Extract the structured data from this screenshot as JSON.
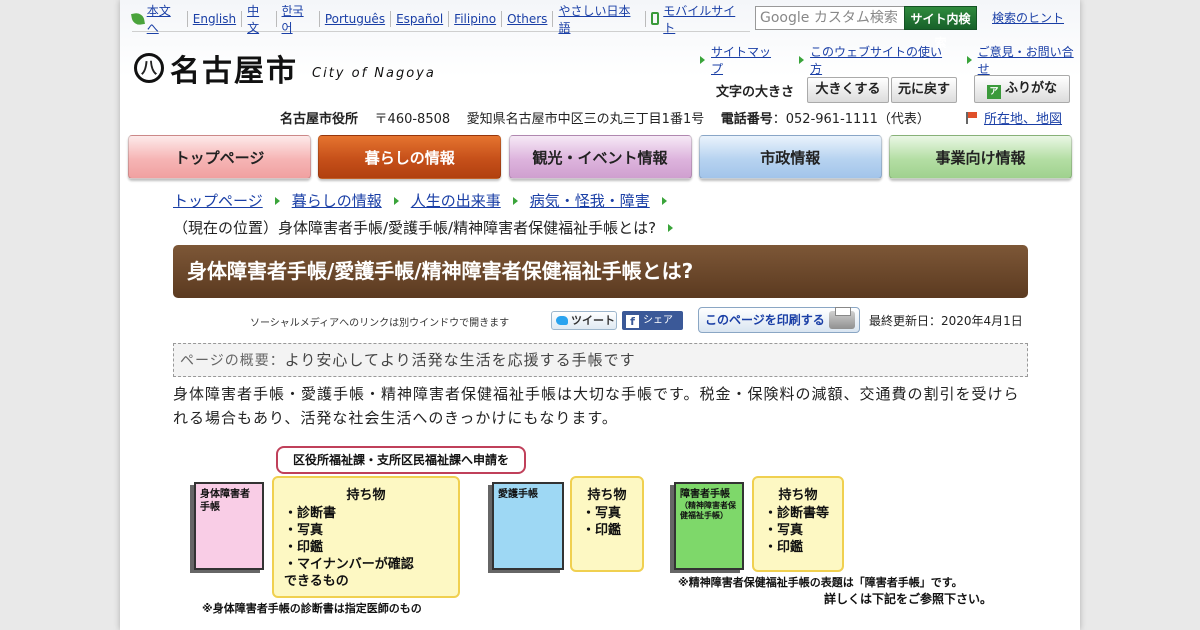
{
  "lang_bar": {
    "items": [
      "本文へ",
      "English",
      "中文",
      "한국어",
      "Português",
      "Español",
      "Filipino",
      "Others",
      "やさしい日本語",
      "モバイルサイト"
    ]
  },
  "search": {
    "placeholder": "Google カスタム検索",
    "button": "サイト内検索",
    "hint": "検索のヒント"
  },
  "logo": {
    "mark": "八",
    "name": "名古屋市",
    "sub": "City of Nagoya"
  },
  "util_links": [
    "サイトマップ",
    "このウェブサイトの使い方",
    "ご意見・お問い合せ"
  ],
  "font_size": {
    "label": "文字の大きさ",
    "larger": "大きくする",
    "reset": "元に戻す",
    "furigana": "ふりがな"
  },
  "address": {
    "office": "名古屋市役所",
    "postal": "〒460-8508",
    "street": "愛知県名古屋市中区三の丸三丁目1番1号",
    "phone_label": "電話番号",
    "phone": "：052-961-1111（代表）",
    "map_link": "所在地、地図"
  },
  "nav": [
    "トップページ",
    "暮らしの情報",
    "観光・イベント情報",
    "市政情報",
    "事業向け情報"
  ],
  "breadcrumb": [
    "トップページ",
    "暮らしの情報",
    "人生の出来事",
    "病気・怪我・障害"
  ],
  "current": "（現在の位置）身体障害者手帳/愛護手帳/精神障害者保健福祉手帳とは?",
  "page_title": "身体障害者手帳/愛護手帳/精神障害者保健福祉手帳とは?",
  "social": {
    "note": "ソーシャルメディアへのリンクは別ウインドウで開きます",
    "tweet": "ツイート",
    "share": "シェア",
    "print": "このページを印刷する",
    "updated": "最終更新日：2020年4月1日"
  },
  "summary": {
    "label": "ページの概要：",
    "text": "より安心してより活発な生活を応援する手帳です"
  },
  "body": "身体障害者手帳・愛護手帳・精神障害者保健福祉手帳は大切な手帳です。税金・保険料の減額、交通費の割引を受けられる場合もあり、活発な社会生活へのきっかけにもなります。",
  "diagram": {
    "apply": "区役所福祉課・支所区民福祉課へ申請を",
    "book1": "身体障害者手帳",
    "list1_title": "持ち物",
    "list1": [
      "・診断書",
      "・写真",
      "・印鑑",
      "・マイナンバーが確認",
      "できるもの"
    ],
    "note1": "※身体障害者手帳の診断書は指定医師のもの",
    "book2": "愛護手帳",
    "list2_title": "持ち物",
    "list2": [
      "・写真",
      "・印鑑"
    ],
    "book3": "障害者手帳",
    "book3_sub": "（精神障害者保健福祉手帳）",
    "list3_title": "持ち物",
    "list3": [
      "・診断書等",
      "・写真",
      "・印鑑"
    ],
    "note3a": "※精神障害者保健福祉手帳の表題は「障害者手帳」です。",
    "note3b": "詳しくは下記をご参照下さい。"
  },
  "colors": {
    "title_bar": "#6b4629",
    "nav_active": "#c6501a",
    "accent_green": "#3aa43a",
    "link": "#1a3fa6"
  }
}
